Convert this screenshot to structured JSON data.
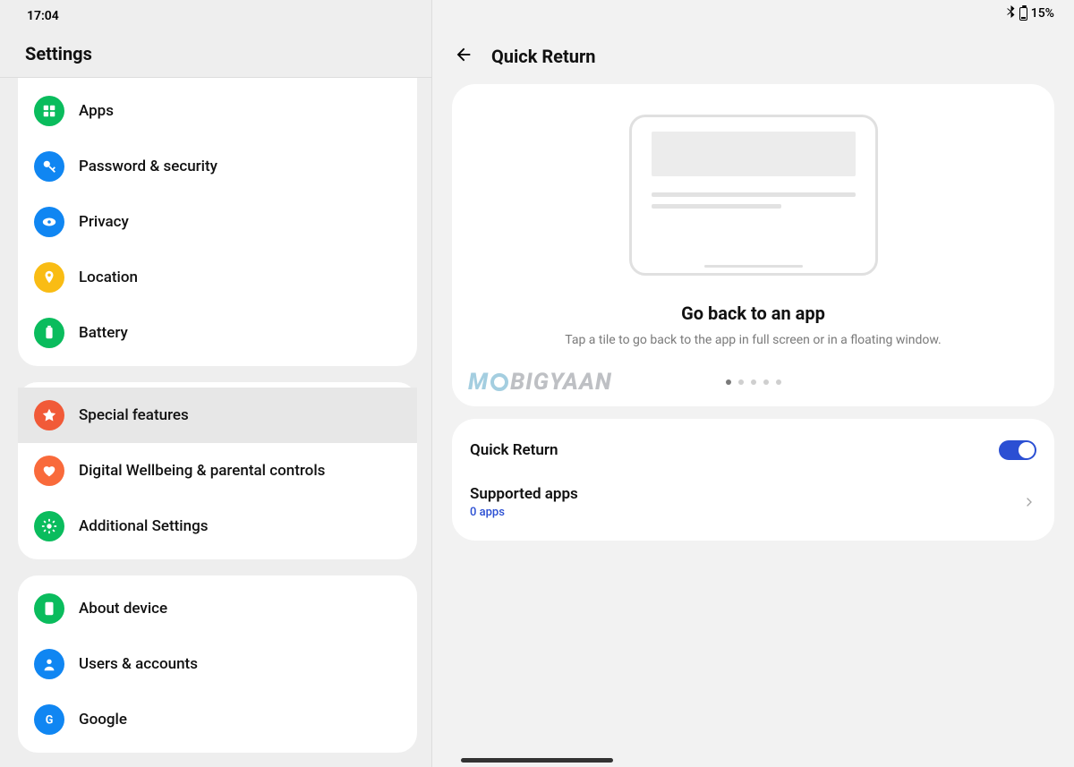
{
  "status": {
    "time": "17:04",
    "bluetooth": "⁕",
    "battery_pct": "15%"
  },
  "left": {
    "title": "Settings",
    "groups": [
      {
        "items": [
          {
            "id": "apps",
            "label": "Apps",
            "color": "c-green",
            "icon": "grid"
          },
          {
            "id": "pwd",
            "label": "Password & security",
            "color": "c-blue",
            "icon": "key"
          },
          {
            "id": "privacy",
            "label": "Privacy",
            "color": "c-blue",
            "icon": "eye"
          },
          {
            "id": "location",
            "label": "Location",
            "color": "c-yellow",
            "icon": "pin"
          },
          {
            "id": "battery",
            "label": "Battery",
            "color": "c-green",
            "icon": "battery"
          }
        ]
      },
      {
        "items": [
          {
            "id": "special",
            "label": "Special features",
            "color": "c-orange",
            "icon": "star",
            "selected": true
          },
          {
            "id": "dwb",
            "label": "Digital Wellbeing & parental controls",
            "color": "c-orange2",
            "icon": "heart"
          },
          {
            "id": "addl",
            "label": "Additional Settings",
            "color": "c-green",
            "icon": "gear"
          }
        ]
      },
      {
        "items": [
          {
            "id": "about",
            "label": "About device",
            "color": "c-green",
            "icon": "device"
          },
          {
            "id": "users",
            "label": "Users & accounts",
            "color": "c-blue",
            "icon": "person"
          },
          {
            "id": "google",
            "label": "Google",
            "color": "c-blue",
            "icon": "g"
          }
        ]
      }
    ]
  },
  "right": {
    "title": "Quick Return",
    "card": {
      "heading": "Go back to an app",
      "desc": "Tap a tile to go back to the app in full screen or in a floating window.",
      "dot_count": 5,
      "active_dot": 0
    },
    "rows": {
      "toggle": {
        "title": "Quick Return",
        "on": true
      },
      "supported": {
        "title": "Supported apps",
        "sub": "0 apps"
      }
    }
  },
  "watermark": {
    "pre": "M",
    "post": "BIGYAAN"
  }
}
